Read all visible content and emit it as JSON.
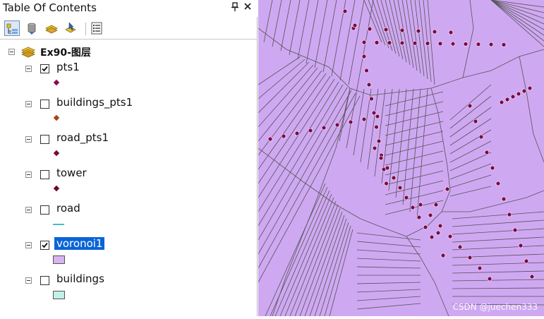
{
  "toc": {
    "title": "Table Of Contents",
    "pin_glyph": "Δ",
    "close_glyph": "✕",
    "toolbar": [
      {
        "icon": "list-by-drawing-order-icon",
        "active": true
      },
      {
        "icon": "list-by-source-icon",
        "active": false
      },
      {
        "icon": "list-by-visibility-icon",
        "active": false
      },
      {
        "icon": "list-by-selection-icon",
        "active": false
      },
      {
        "icon": "options-icon",
        "active": false
      }
    ],
    "data_frame": {
      "label": "Ex90-图层",
      "expanded": true
    },
    "layers": [
      {
        "name": "pts1",
        "checked": true,
        "selected": false,
        "symbol": "point",
        "color": "#8b0a50"
      },
      {
        "name": "buildings_pts1",
        "checked": false,
        "selected": false,
        "symbol": "point",
        "color": "#a8421a"
      },
      {
        "name": "road_pts1",
        "checked": false,
        "selected": false,
        "symbol": "point",
        "color": "#7a0a30"
      },
      {
        "name": "tower",
        "checked": false,
        "selected": false,
        "symbol": "point",
        "color": "#6b0a20"
      },
      {
        "name": "road",
        "checked": false,
        "selected": false,
        "symbol": "line",
        "color": "#4fb8c4"
      },
      {
        "name": "voronoi1",
        "checked": true,
        "selected": true,
        "symbol": "polygon",
        "color": "#d8b4f0"
      },
      {
        "name": "buildings",
        "checked": false,
        "selected": false,
        "symbol": "polygon",
        "color": "#c2efe6"
      }
    ]
  },
  "map": {
    "fill_color": "#cfa8f2",
    "edge_color": "#555555",
    "point_color": "#7b0a4c"
  },
  "watermark": "CSDN @juechen333"
}
